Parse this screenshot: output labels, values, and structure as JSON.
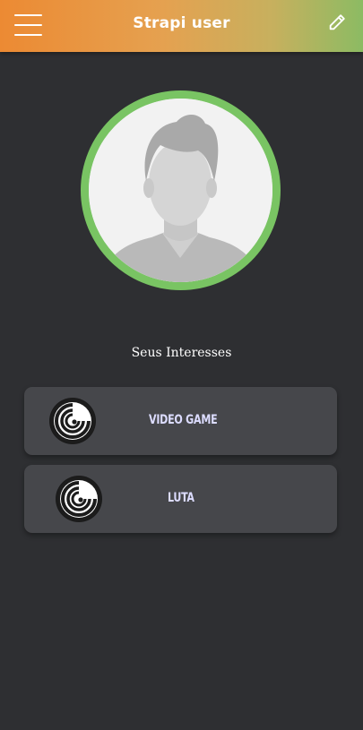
{
  "header": {
    "title": "Strapi user",
    "menu_icon": "hamburger-menu-icon",
    "edit_icon": "pencil-icon",
    "gradient_start": "#ec8a33",
    "gradient_end": "#8cbb63"
  },
  "profile": {
    "avatar_icon": "default-user-avatar-icon",
    "ring_color": "#79c463"
  },
  "interests": {
    "heading": "Seus Interesses",
    "items": [
      {
        "label": "VIDEO GAME",
        "icon": "ubisoft-swirl-icon"
      },
      {
        "label": "LUTA",
        "icon": "ubisoft-swirl-icon"
      }
    ]
  },
  "colors": {
    "background": "#2e2f32",
    "card": "#46474b",
    "card_text": "#dcdcff"
  }
}
